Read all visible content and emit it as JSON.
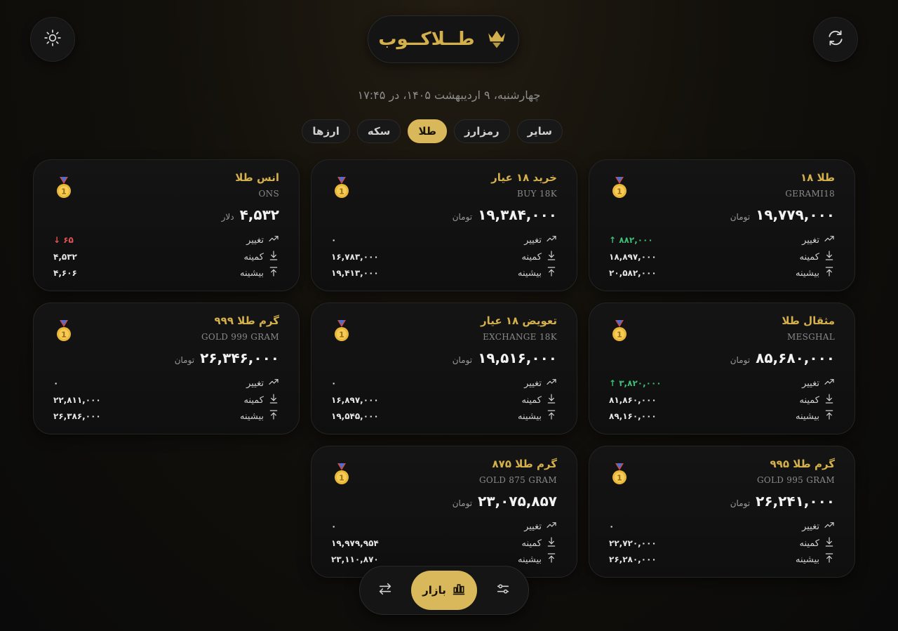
{
  "header": {
    "logo_text": "طــلاکــوب",
    "date_text": "چهارشنبه، ۹ اردیبهشت ۱۴۰۵، در ۱۷:۴۵"
  },
  "tabs": [
    {
      "label": "سایر",
      "active": false
    },
    {
      "label": "رمزارز",
      "active": false
    },
    {
      "label": "طلا",
      "active": true
    },
    {
      "label": "سکه",
      "active": false
    },
    {
      "label": "ارزها",
      "active": false
    }
  ],
  "labels": {
    "change": "تغییر",
    "min": "کمینه",
    "max": "بیشینه"
  },
  "cards": [
    {
      "title": "طلا ۱۸",
      "sub": "GERAMI18",
      "price": "۱۹,۷۷۹,۰۰۰",
      "unit": "تومان",
      "change": "۸۸۲,۰۰۰",
      "change_dir": "up",
      "min": "۱۸,۸۹۷,۰۰۰",
      "max": "۲۰,۵۸۲,۰۰۰"
    },
    {
      "title": "خرید ۱۸ عیار",
      "sub": "BUY 18K",
      "price": "۱۹,۳۸۴,۰۰۰",
      "unit": "تومان",
      "change": "۰",
      "change_dir": "none",
      "min": "۱۶,۷۸۳,۰۰۰",
      "max": "۱۹,۴۱۳,۰۰۰"
    },
    {
      "title": "انس طلا",
      "sub": "ONS",
      "price": "۴,۵۳۲",
      "unit": "دلار",
      "change": "۶۵",
      "change_dir": "down",
      "min": "۴,۵۳۲",
      "max": "۴,۶۰۶"
    },
    {
      "title": "مثقال طلا",
      "sub": "MESGHAL",
      "price": "۸۵,۶۸۰,۰۰۰",
      "unit": "تومان",
      "change": "۳,۸۲۰,۰۰۰",
      "change_dir": "up",
      "min": "۸۱,۸۶۰,۰۰۰",
      "max": "۸۹,۱۶۰,۰۰۰"
    },
    {
      "title": "تعویض ۱۸ عیار",
      "sub": "EXCHANGE 18K",
      "price": "۱۹,۵۱۶,۰۰۰",
      "unit": "تومان",
      "change": "۰",
      "change_dir": "none",
      "min": "۱۶,۸۹۷,۰۰۰",
      "max": "۱۹,۵۴۵,۰۰۰"
    },
    {
      "title": "گرم طلا ۹۹۹",
      "sub": "GOLD 999 GRAM",
      "price": "۲۶,۳۴۶,۰۰۰",
      "unit": "تومان",
      "change": "۰",
      "change_dir": "none",
      "min": "۲۲,۸۱۱,۰۰۰",
      "max": "۲۶,۳۸۶,۰۰۰"
    },
    {
      "title": "گرم طلا ۹۹۵",
      "sub": "GOLD 995 GRAM",
      "price": "۲۶,۲۴۱,۰۰۰",
      "unit": "تومان",
      "change": "۰",
      "change_dir": "none",
      "min": "۲۲,۷۲۰,۰۰۰",
      "max": "۲۶,۲۸۰,۰۰۰"
    },
    {
      "title": "گرم طلا ۸۷۵",
      "sub": "GOLD 875 GRAM",
      "price": "۲۳,۰۷۵,۸۵۷",
      "unit": "تومان",
      "change": "۰",
      "change_dir": "none",
      "min": "۱۹,۹۷۹,۹۵۴",
      "max": "۲۳,۱۱۰,۸۷۰"
    }
  ],
  "bottom_nav": {
    "active_label": "بازار"
  },
  "colors": {
    "accent": "#d8b85a",
    "up": "#3fbf76",
    "down": "#e05252"
  }
}
